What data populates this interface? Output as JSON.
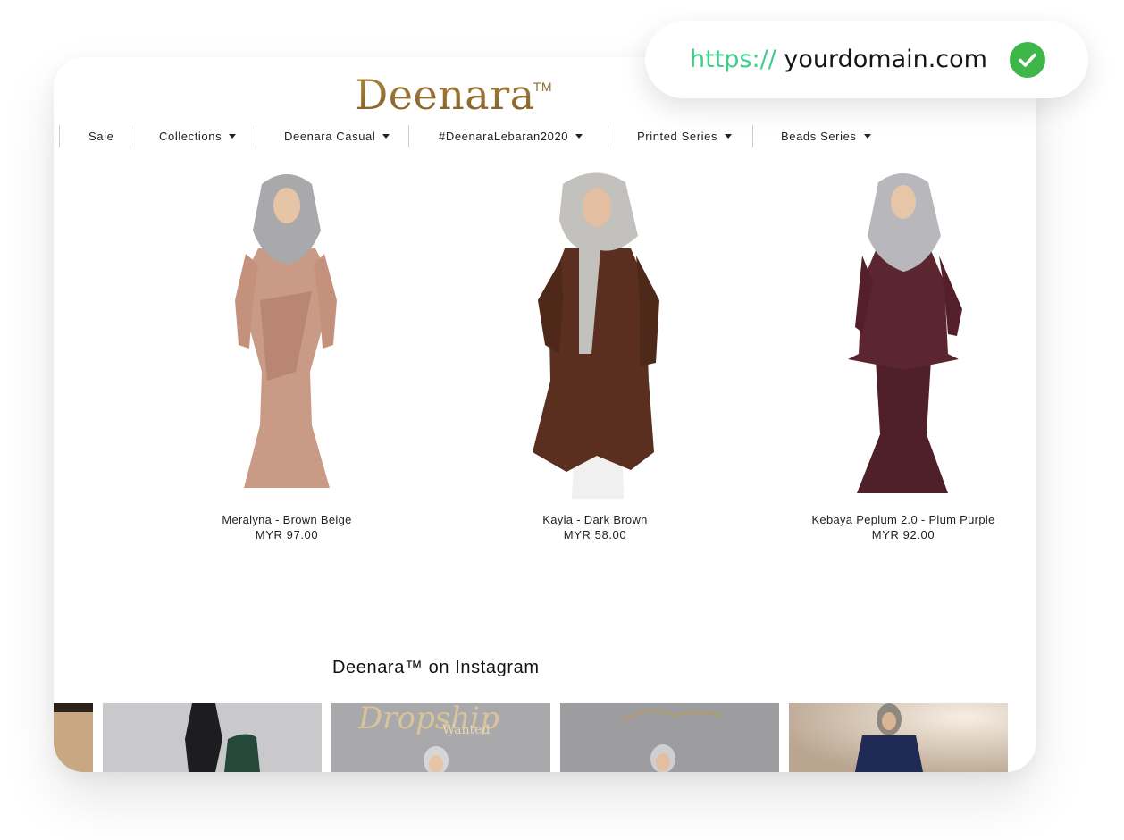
{
  "browser": {
    "url_scheme": "https://",
    "url_domain": "yourdomain.com",
    "secure_icon": "check-circle-icon",
    "accent_color": "#3ccf88",
    "check_color": "#3fb64a"
  },
  "site": {
    "logo_text": "Deenara",
    "logo_tm": "TM",
    "brand_color": "#8c6a2e"
  },
  "nav": {
    "items": [
      {
        "label": "Sale"
      },
      {
        "label": "Collections"
      },
      {
        "label": "Deenara Casual"
      },
      {
        "label": "#DeenaraLebaran2020"
      },
      {
        "label": "Printed Series"
      },
      {
        "label": "Beads Series"
      }
    ]
  },
  "products": [
    {
      "name": "Meralyna - Brown Beige",
      "price": "MYR 97.00",
      "color": "#c99a85"
    },
    {
      "name": "Kayla - Dark Brown",
      "price": "MYR 58.00",
      "color": "#5a2f1f"
    },
    {
      "name": "Kebaya Peplum 2.0 - Plum Purple",
      "price": "MYR 92.00",
      "color": "#5b2630"
    }
  ],
  "instagram": {
    "title": "Deenara™ on Instagram",
    "overlay_texts": [
      "Dropship",
      "Wanted"
    ]
  }
}
